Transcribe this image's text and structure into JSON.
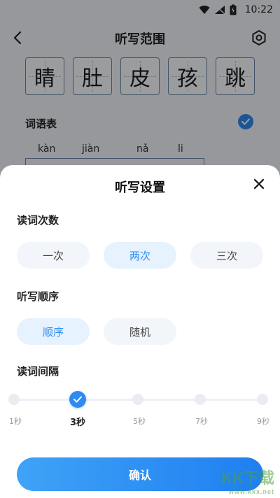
{
  "status_bar": {
    "time": "10:22"
  },
  "header": {
    "title": "听写范围"
  },
  "characters": [
    "睛",
    "肚",
    "皮",
    "孩",
    "跳"
  ],
  "word_list": {
    "title": "词语表",
    "pinyin": [
      "kàn",
      "jiàn",
      "nǎ",
      "li"
    ]
  },
  "sheet": {
    "title": "听写设置",
    "read_count": {
      "label": "读词次数",
      "options": [
        "一次",
        "两次",
        "三次"
      ],
      "selected": "两次"
    },
    "order": {
      "label": "听写顺序",
      "options": [
        "顺序",
        "随机"
      ],
      "selected": "顺序"
    },
    "interval": {
      "label": "读词间隔",
      "ticks": [
        "1秒",
        "3秒",
        "5秒",
        "7秒",
        "9秒"
      ],
      "selected": "3秒"
    },
    "confirm_label": "确认"
  },
  "watermark": {
    "text": "KK下载",
    "sub": "www.kkx.net"
  },
  "colors": {
    "accent": "#2e8cf0",
    "pill_bg": "#f2f5f9",
    "pill_selected_bg": "#e6f2fd"
  }
}
